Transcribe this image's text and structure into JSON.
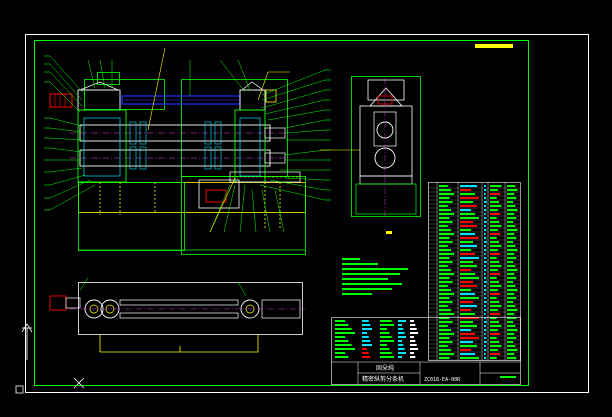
{
  "title_block": {
    "company": "固朵纯",
    "drawing_name": "精密纵剪分条机",
    "drawing_number": "ZC018-EA-00R"
  },
  "colors": {
    "background": "#000000",
    "frame": "#ffffff",
    "green": "#00ff00",
    "cyan": "#00e5ff",
    "yellow": "#ffff00",
    "red": "#ff0000",
    "magenta": "#ff40ff",
    "blue": "#2030ff",
    "white": "#ffffff"
  },
  "icons": {
    "ucs": "ucs-axis-icon",
    "origin": "origin-marker-icon"
  }
}
